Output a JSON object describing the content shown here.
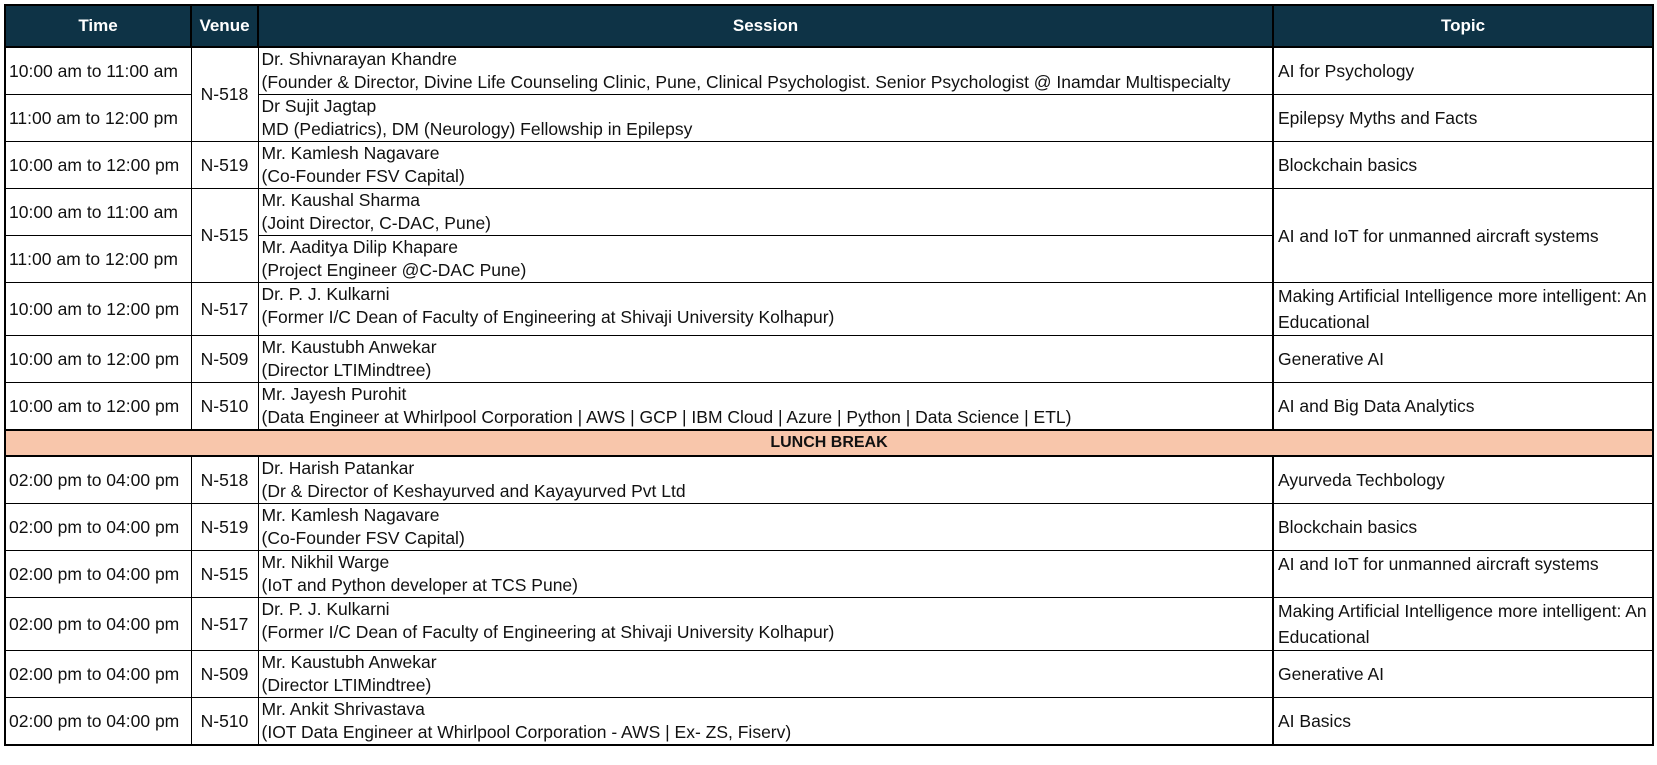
{
  "header": {
    "time": "Time",
    "venue": "Venue",
    "session": "Session",
    "topic": "Topic"
  },
  "colors": {
    "header_bg": "#0e3346",
    "header_text": "#ffffff",
    "break_bg": "#f8c6ab",
    "grid": "#000000"
  },
  "morning": [
    {
      "time": "10:00 am to 11:00 am",
      "venue": "N-518",
      "speaker": "Dr. Shivnarayan Khandre",
      "affiliation": "(Founder & Director, Divine Life Counseling Clinic, Pune, Clinical Psychologist. Senior Psychologist @ Inamdar Multispecialty",
      "topic": "AI for Psychology"
    },
    {
      "time": "11:00 am to 12:00 pm",
      "venue": "N-518",
      "speaker": "Dr Sujit Jagtap",
      "affiliation": "MD (Pediatrics), DM (Neurology) Fellowship in Epilepsy",
      "topic": "Epilepsy Myths and Facts"
    },
    {
      "time": "10:00 am to 12:00 pm",
      "venue": "N-519",
      "speaker": "Mr. Kamlesh Nagavare",
      "affiliation": "(Co-Founder FSV Capital)",
      "topic": "Blockchain  basics"
    },
    {
      "time": "10:00 am to 11:00 am",
      "venue": "N-515",
      "speaker": "Mr. Kaushal Sharma",
      "affiliation": " (Joint Director, C-DAC, Pune)",
      "topic": "AI and IoT for unmanned aircraft systems"
    },
    {
      "time": "11:00 am to 12:00 pm",
      "venue": "N-515",
      "speaker": "Mr. Aaditya Dilip Khapare",
      "affiliation": "(Project Engineer @C-DAC Pune)",
      "topic": "AI and IoT for unmanned aircraft systems"
    },
    {
      "time": "10:00 am to 12:00 pm",
      "venue": "N-517",
      "speaker": "Dr. P. J. Kulkarni",
      "affiliation": "(Former I/C Dean of Faculty of Engineering at Shivaji University Kolhapur)",
      "topic": "Making Artificial Intelligence more intelligent: An Educational"
    },
    {
      "time": "10:00 am to 12:00 pm",
      "venue": "N-509",
      "speaker": "Mr. Kaustubh Anwekar",
      "affiliation": "(Director LTIMindtree)",
      "topic": "Generative AI"
    },
    {
      "time": "10:00 am to 12:00 pm",
      "venue": "N-510",
      "speaker": "Mr. Jayesh Purohit",
      "affiliation": "(Data Engineer at Whirlpool Corporation | AWS | GCP | IBM Cloud | Azure | Python | Data Science | ETL)",
      "topic": "AI and Big Data Analytics"
    }
  ],
  "break_label": "LUNCH BREAK",
  "afternoon": [
    {
      "time": "02:00 pm to 04:00 pm",
      "venue": "N-518",
      "speaker": "Dr. Harish Patankar",
      "affiliation": "(Dr & Director of Keshayurved and Kayayurved Pvt Ltd",
      "topic": "Ayurveda Techbology"
    },
    {
      "time": "02:00 pm to 04:00 pm",
      "venue": "N-519",
      "speaker": "Mr. Kamlesh Nagavare",
      "affiliation": "(Co-Founder FSV Capital)",
      "topic": "Blockchain  basics"
    },
    {
      "time": "02:00 pm to 04:00 pm",
      "venue": "N-515",
      "speaker": "Mr. Nikhil Warge",
      "affiliation": "(IoT and Python developer at TCS Pune)",
      "topic": "AI and IoT for unmanned aircraft systems"
    },
    {
      "time": "02:00 pm to 04:00 pm",
      "venue": "N-517",
      "speaker": "Dr. P. J. Kulkarni",
      "affiliation": "(Former I/C Dean of Faculty of Engineering at Shivaji University Kolhapur)",
      "topic": "Making Artificial Intelligence more intelligent: An Educational"
    },
    {
      "time": "02:00 pm to 04:00 pm",
      "venue": "N-509",
      "speaker": "Mr. Kaustubh Anwekar",
      "affiliation": "(Director LTIMindtree)",
      "topic": "Generative AI"
    },
    {
      "time": "02:00 pm to 04:00 pm",
      "venue": "N-510",
      "speaker": "Mr. Ankit Shrivastava",
      "affiliation": "(IOT Data Engineer at Whirlpool Corporation - AWS | Ex- ZS, Fiserv)",
      "topic": "AI Basics"
    }
  ]
}
